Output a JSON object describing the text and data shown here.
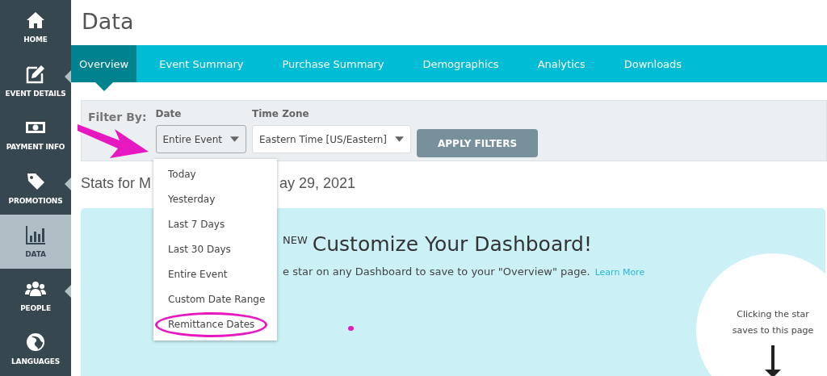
{
  "sidebar": {
    "items": [
      {
        "label": "HOME",
        "selected": false,
        "submenu": false
      },
      {
        "label": "EVENT DETAILS",
        "selected": false,
        "submenu": true
      },
      {
        "label": "PAYMENT INFO",
        "selected": false,
        "submenu": false
      },
      {
        "label": "PROMOTIONS",
        "selected": false,
        "submenu": true
      },
      {
        "label": "DATA",
        "selected": true,
        "submenu": false
      },
      {
        "label": "PEOPLE",
        "selected": false,
        "submenu": true
      },
      {
        "label": "LANGUAGES",
        "selected": false,
        "submenu": false
      }
    ]
  },
  "page_title": "Data",
  "tabs": [
    {
      "label": "Overview",
      "selected": true
    },
    {
      "label": "Event Summary",
      "selected": false
    },
    {
      "label": "Purchase Summary",
      "selected": false
    },
    {
      "label": "Demographics",
      "selected": false
    },
    {
      "label": "Analytics",
      "selected": false
    },
    {
      "label": "Downloads",
      "selected": false
    }
  ],
  "filter_bar": {
    "label": "Filter By:",
    "date": {
      "label": "Date",
      "value": "Entire Event",
      "open": true
    },
    "time_zone": {
      "label": "Time Zone",
      "value": "Eastern Time [US/Eastern]"
    },
    "apply_button": "APPLY FILTERS"
  },
  "date_menu": [
    {
      "label": "Today",
      "circled": false
    },
    {
      "label": "Yesterday",
      "circled": false
    },
    {
      "label": "Last 7 Days",
      "circled": false
    },
    {
      "label": "Last 30 Days",
      "circled": false
    },
    {
      "label": "Entire Event",
      "circled": false
    },
    {
      "label": "Custom Date Range",
      "circled": false
    },
    {
      "label": "Remittance Dates",
      "circled": true
    }
  ],
  "stats_heading": [
    "Stats for M",
    "ay 29, 2021"
  ],
  "banner": {
    "badge": "NEW",
    "title": "Customize Your Dashboard!",
    "text": "e star on any Dashboard to save to your \"Overview\" page.",
    "link": "Learn More",
    "callout": "Clicking the star saves to this page"
  }
}
